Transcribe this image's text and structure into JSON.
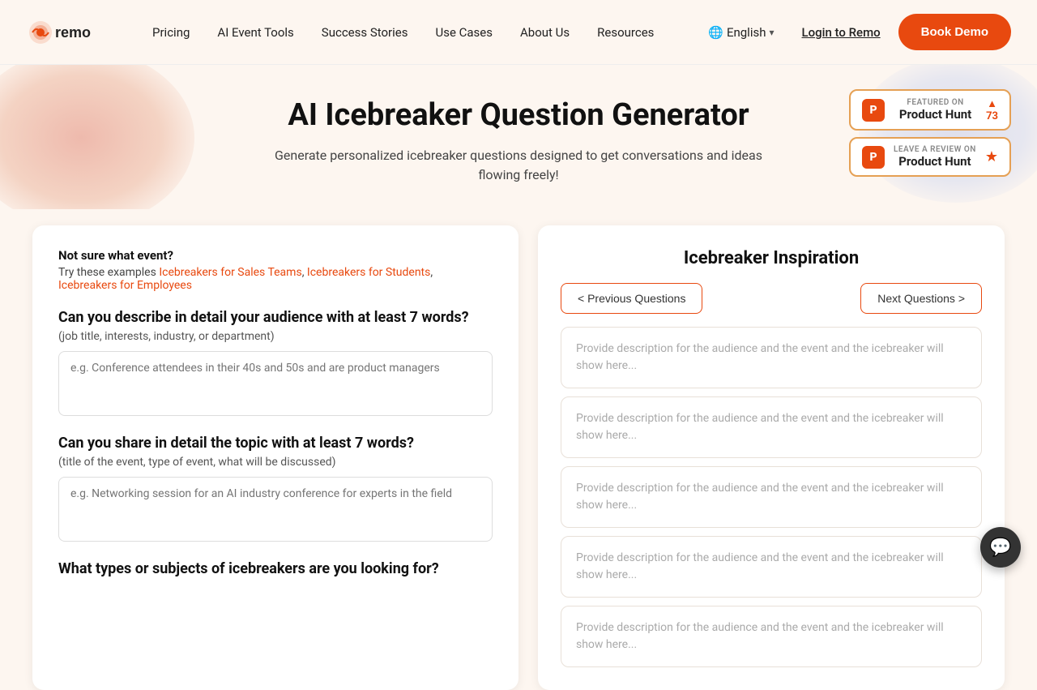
{
  "brand": {
    "name": "Remo",
    "logo_text": "remo"
  },
  "navbar": {
    "pricing_label": "Pricing",
    "ai_event_tools_label": "AI Event Tools",
    "success_stories_label": "Success Stories",
    "use_cases_label": "Use Cases",
    "about_us_label": "About Us",
    "resources_label": "Resources",
    "language_label": "English",
    "login_label": "Login to Remo",
    "book_demo_label": "Book Demo"
  },
  "hero": {
    "title": "AI Icebreaker Question Generator",
    "subtitle": "Generate personalized icebreaker questions designed to get conversations and ideas flowing freely!"
  },
  "product_hunt": {
    "badge1": {
      "label": "FEATURED ON",
      "name": "Product Hunt",
      "count": "73",
      "arrow": "▲"
    },
    "badge2": {
      "label": "LEAVE A REVIEW ON",
      "name": "Product Hunt"
    }
  },
  "form": {
    "not_sure_title": "Not sure what event?",
    "not_sure_text": "Try these examples",
    "example_links": [
      "Icebreakers for Sales Teams",
      "Icebreakers for Students",
      "Icebreakers for Employees"
    ],
    "question1_label": "Can you describe in detail your audience with at least 7 words?",
    "question1_hint": "(job title, interests, industry, or department)",
    "question1_placeholder": "e.g. Conference attendees in their 40s and 50s and are product managers",
    "question2_label": "Can you share in detail the topic with at least 7 words?",
    "question2_hint": "(title of the event, type of event, what will be discussed)",
    "question2_placeholder": "e.g. Networking session for an AI industry conference for experts in the field",
    "question3_label": "What types or subjects of icebreakers are you looking for?"
  },
  "inspiration": {
    "title": "Icebreaker Inspiration",
    "prev_label": "< Previous Questions",
    "next_label": "Next Questions >",
    "cards": [
      {
        "text": "Provide description for the audience and the event and the icebreaker will show here..."
      },
      {
        "text": "Provide description for the audience and the event and the icebreaker will show here..."
      },
      {
        "text": "Provide description for the audience and the event and the icebreaker will show here..."
      },
      {
        "text": "Provide description for the audience and the event and the icebreaker will show here..."
      },
      {
        "text": "Provide description for the audience and the event and the icebreaker will show here..."
      }
    ]
  },
  "chat": {
    "icon": "💬"
  }
}
